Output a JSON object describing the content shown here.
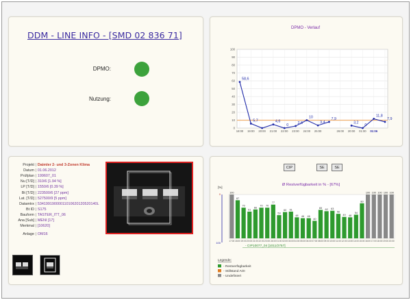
{
  "line_info": {
    "title": "DDM - LINE INFO  -  [SMD  02  836  71]",
    "indicators": [
      {
        "label": "DPMO:",
        "color": "#3ca23c"
      },
      {
        "label": "Nutzung:",
        "color": "#3ca23c"
      }
    ]
  },
  "product": {
    "rows": [
      {
        "key": "Projekt",
        "value": "Daimler 2- und 3-Zonen Klima",
        "highlight": true
      },
      {
        "key": "Datum",
        "value": "01.06.2012"
      },
      {
        "key": "Prüfplan",
        "value": "199607_01"
      },
      {
        "key": "Nu [T/D]",
        "value": "310/6 [1.94 %]"
      },
      {
        "key": "LP [T/D]",
        "value": "1550/6 [0.39 %]"
      },
      {
        "key": "Bt [T/D]",
        "value": "223500/6 [27 ppm]"
      },
      {
        "key": "Lat. [T/D]",
        "value": "527500/9 [5 ppm]"
      },
      {
        "key": "Datamtrx",
        "value": "53419919000011010620120520140L"
      },
      {
        "key": "Bt ID",
        "value": "S175"
      },
      {
        "key": "Bauform",
        "value": "TASTER_ITT_06"
      },
      {
        "key": "Ana [Sub]",
        "value": "MENI [17]"
      },
      {
        "key": "Merkmal",
        "value": "[10620]"
      },
      {
        "key": "Anlage",
        "value": "OM16"
      }
    ]
  },
  "controls": {
    "buttons": [
      "CIP",
      "SE",
      "SE"
    ],
    "avail_title": "Ø Restverfügbarkeit in % - [67%]",
    "percent_unit": "[%]",
    "filter_link": "- CIP10077_04 [1011/2757]",
    "legend_title": "Legende:",
    "legend": [
      {
        "label": "- Restverfügbarkeit",
        "color": "#2e9a2e"
      },
      {
        "label": "- Stillstand AOI",
        "color": "#e07b1e"
      },
      {
        "label": "- Undefiniert",
        "color": "#888888"
      }
    ]
  },
  "chart_data": [
    {
      "type": "line",
      "title": "DPMO - Verlauf",
      "ylim": [
        0,
        100
      ],
      "yticks": [
        0,
        10,
        20,
        30,
        40,
        50,
        60,
        70,
        80,
        90,
        100
      ],
      "grid": true,
      "threshold": 10,
      "threshold_color": "#f0b070",
      "line_color": "#1f2aa8",
      "x": [
        "18:00",
        "19:00",
        "20:00",
        "21:00",
        "22:00",
        "23:00",
        "24:00",
        "25:00",
        "",
        "26:00",
        "20:00",
        "01:00",
        "01:06"
      ],
      "values": [
        58.6,
        5.7,
        0,
        4.6,
        0,
        2.6,
        10,
        3.4,
        7.9,
        null,
        3.2,
        0,
        11.8,
        7.9
      ],
      "data_labels": [
        "58,6",
        "5,7",
        "",
        "4,6",
        "0",
        "2,6",
        "10",
        "3,4",
        "7,9",
        "",
        "3,2",
        "0",
        "11,8",
        "7,9"
      ]
    },
    {
      "type": "bar",
      "title": "Ø Restverfügbarkeit in % - [67%]",
      "ylim": [
        0,
        100
      ],
      "ylabel": "[%]",
      "categories": [
        "17:00",
        "18:00",
        "19:00",
        "20:00",
        "21:00",
        "22:00",
        "23:00",
        "24:00",
        "01:00",
        "02:00",
        "03:00",
        "04:00",
        "05:00",
        "06:00",
        "07:00",
        "08:00",
        "09:00",
        "10:00",
        "11:00",
        "12:00",
        "13:00",
        "14:00",
        "15:00",
        "16:00",
        "17:00",
        "18:00",
        "19:00",
        "20:00"
      ],
      "values": [
        100,
        87,
        70,
        61,
        66,
        70,
        70,
        77,
        53,
        60,
        61,
        48,
        46,
        46,
        40,
        65,
        62,
        63,
        56,
        49,
        48,
        54,
        80,
        100,
        100,
        100,
        100,
        100
      ],
      "colors": [
        "#888888",
        "#2e9a2e",
        "#2e9a2e",
        "#2e9a2e",
        "#2e9a2e",
        "#2e9a2e",
        "#2e9a2e",
        "#2e9a2e",
        "#2e9a2e",
        "#2e9a2e",
        "#2e9a2e",
        "#2e9a2e",
        "#2e9a2e",
        "#2e9a2e",
        "#2e9a2e",
        "#2e9a2e",
        "#2e9a2e",
        "#2e9a2e",
        "#2e9a2e",
        "#2e9a2e",
        "#2e9a2e",
        "#2e9a2e",
        "#2e9a2e",
        "#888888",
        "#888888",
        "#888888",
        "#888888",
        "#888888"
      ]
    }
  ]
}
